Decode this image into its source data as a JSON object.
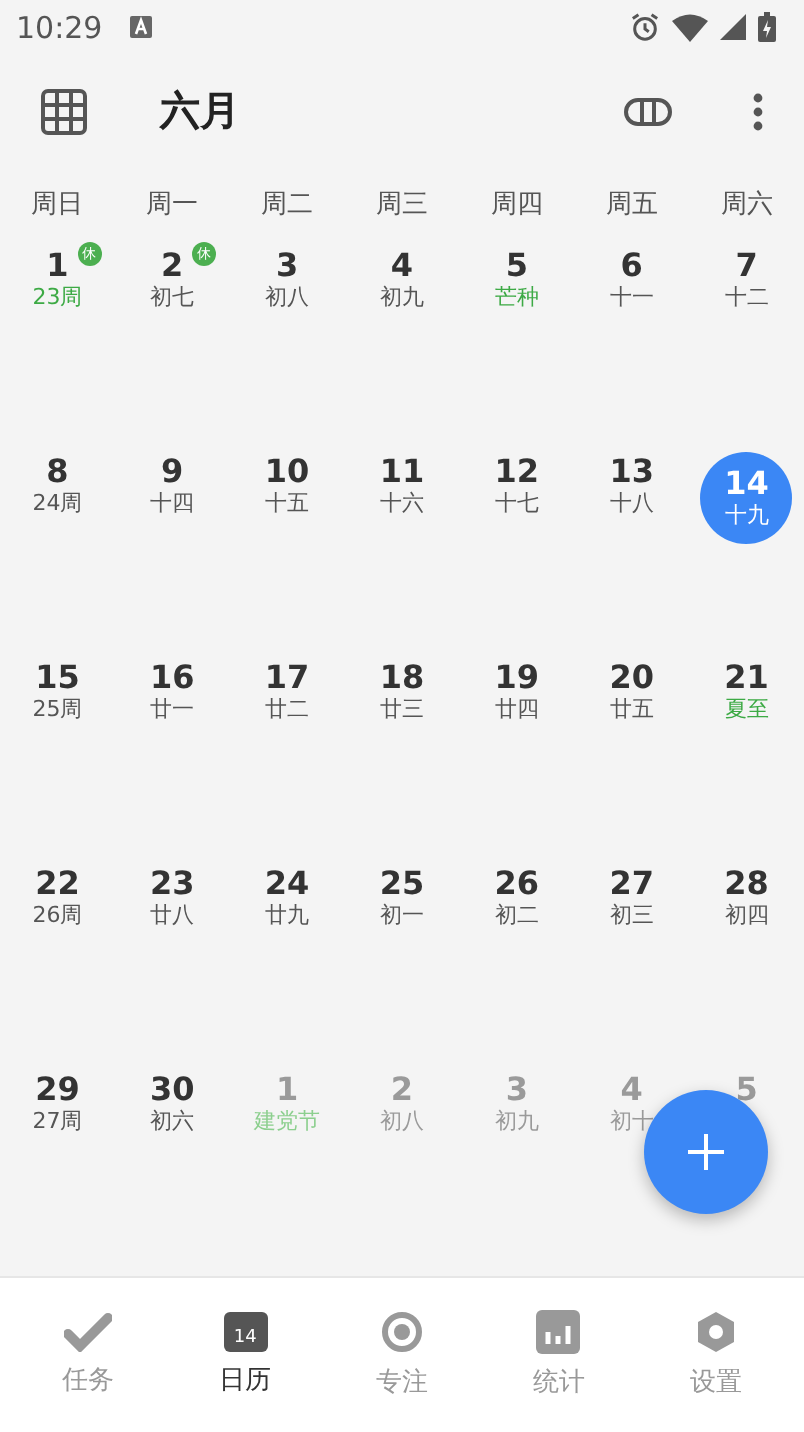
{
  "status_bar": {
    "time": "10:29"
  },
  "header": {
    "title": "六月"
  },
  "weekdays": [
    "周日",
    "周一",
    "周二",
    "周三",
    "周四",
    "周五",
    "周六"
  ],
  "weeks": [
    [
      {
        "day": "1",
        "sub": "23周",
        "sub_accent": true,
        "dimmed": false,
        "selected": false,
        "badge": "休"
      },
      {
        "day": "2",
        "sub": "初七",
        "sub_accent": false,
        "dimmed": false,
        "selected": false,
        "badge": "休"
      },
      {
        "day": "3",
        "sub": "初八",
        "sub_accent": false,
        "dimmed": false,
        "selected": false
      },
      {
        "day": "4",
        "sub": "初九",
        "sub_accent": false,
        "dimmed": false,
        "selected": false
      },
      {
        "day": "5",
        "sub": "芒种",
        "sub_accent": true,
        "dimmed": false,
        "selected": false
      },
      {
        "day": "6",
        "sub": "十一",
        "sub_accent": false,
        "dimmed": false,
        "selected": false
      },
      {
        "day": "7",
        "sub": "十二",
        "sub_accent": false,
        "dimmed": false,
        "selected": false
      }
    ],
    [
      {
        "day": "8",
        "sub": "24周",
        "sub_accent": false,
        "dimmed": false,
        "selected": false
      },
      {
        "day": "9",
        "sub": "十四",
        "sub_accent": false,
        "dimmed": false,
        "selected": false
      },
      {
        "day": "10",
        "sub": "十五",
        "sub_accent": false,
        "dimmed": false,
        "selected": false
      },
      {
        "day": "11",
        "sub": "十六",
        "sub_accent": false,
        "dimmed": false,
        "selected": false
      },
      {
        "day": "12",
        "sub": "十七",
        "sub_accent": false,
        "dimmed": false,
        "selected": false
      },
      {
        "day": "13",
        "sub": "十八",
        "sub_accent": false,
        "dimmed": false,
        "selected": false
      },
      {
        "day": "14",
        "sub": "十九",
        "sub_accent": false,
        "dimmed": false,
        "selected": true
      }
    ],
    [
      {
        "day": "15",
        "sub": "25周",
        "sub_accent": false,
        "dimmed": false,
        "selected": false
      },
      {
        "day": "16",
        "sub": "廿一",
        "sub_accent": false,
        "dimmed": false,
        "selected": false
      },
      {
        "day": "17",
        "sub": "廿二",
        "sub_accent": false,
        "dimmed": false,
        "selected": false
      },
      {
        "day": "18",
        "sub": "廿三",
        "sub_accent": false,
        "dimmed": false,
        "selected": false
      },
      {
        "day": "19",
        "sub": "廿四",
        "sub_accent": false,
        "dimmed": false,
        "selected": false
      },
      {
        "day": "20",
        "sub": "廿五",
        "sub_accent": false,
        "dimmed": false,
        "selected": false
      },
      {
        "day": "21",
        "sub": "夏至",
        "sub_accent": true,
        "dimmed": false,
        "selected": false
      }
    ],
    [
      {
        "day": "22",
        "sub": "26周",
        "sub_accent": false,
        "dimmed": false,
        "selected": false
      },
      {
        "day": "23",
        "sub": "廿八",
        "sub_accent": false,
        "dimmed": false,
        "selected": false
      },
      {
        "day": "24",
        "sub": "廿九",
        "sub_accent": false,
        "dimmed": false,
        "selected": false
      },
      {
        "day": "25",
        "sub": "初一",
        "sub_accent": false,
        "dimmed": false,
        "selected": false
      },
      {
        "day": "26",
        "sub": "初二",
        "sub_accent": false,
        "dimmed": false,
        "selected": false
      },
      {
        "day": "27",
        "sub": "初三",
        "sub_accent": false,
        "dimmed": false,
        "selected": false
      },
      {
        "day": "28",
        "sub": "初四",
        "sub_accent": false,
        "dimmed": false,
        "selected": false
      }
    ],
    [
      {
        "day": "29",
        "sub": "27周",
        "sub_accent": false,
        "dimmed": false,
        "selected": false
      },
      {
        "day": "30",
        "sub": "初六",
        "sub_accent": false,
        "dimmed": false,
        "selected": false
      },
      {
        "day": "1",
        "sub": "建党节",
        "sub_accent": true,
        "dimmed": true,
        "selected": false
      },
      {
        "day": "2",
        "sub": "初八",
        "sub_accent": false,
        "dimmed": true,
        "selected": false
      },
      {
        "day": "3",
        "sub": "初九",
        "sub_accent": false,
        "dimmed": true,
        "selected": false
      },
      {
        "day": "4",
        "sub": "初十",
        "sub_accent": false,
        "dimmed": true,
        "selected": false
      },
      {
        "day": "5",
        "dimmed": true,
        "selected": false
      }
    ]
  ],
  "nav": [
    {
      "label": "任务",
      "kind": "check",
      "selected": false
    },
    {
      "label": "日历",
      "kind": "calendar",
      "icon_text": "14",
      "selected": true
    },
    {
      "label": "专注",
      "kind": "focus",
      "selected": false
    },
    {
      "label": "统计",
      "kind": "stats",
      "selected": false
    },
    {
      "label": "设置",
      "kind": "settings",
      "selected": false
    }
  ]
}
